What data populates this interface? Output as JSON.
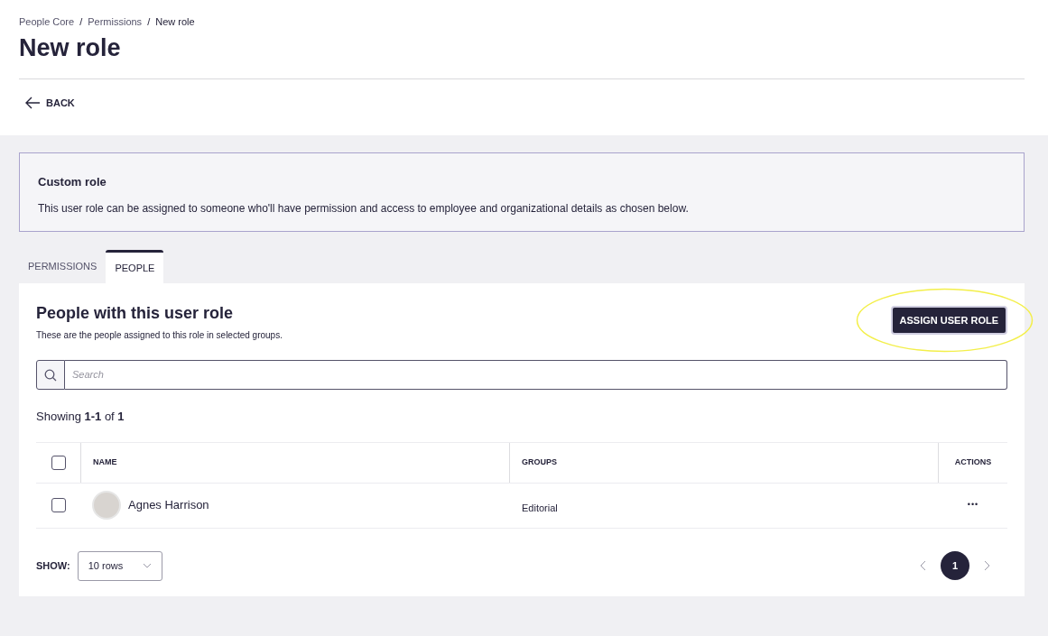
{
  "breadcrumb": [
    "People Core",
    "Permissions",
    "New role"
  ],
  "breadcrumb_separator": "/",
  "title": "New role",
  "back": "BACK",
  "info_card": {
    "title": "Custom role",
    "text": "This user role can be assigned to someone who'll have permission and access to employee and organizational details as chosen below."
  },
  "tabs": [
    {
      "label": "PERMISSIONS",
      "selected": false
    },
    {
      "label": "PEOPLE",
      "selected": true
    }
  ],
  "panel": {
    "title": "People with this user role",
    "subtitle": "These are the people assigned to this role in selected groups.",
    "assign_button": "ASSIGN USER ROLE",
    "highlighted": true
  },
  "search": {
    "placeholder": "Search"
  },
  "showing": "Showing **1-1** of **1**",
  "table": {
    "select_all_checked": false,
    "columns": [
      "NAME",
      "GROUPS",
      "ACTIONS"
    ],
    "rows": [
      {
        "name": "Agnes Harrison",
        "groups": "Editorial",
        "actions": "•••",
        "checked": false
      }
    ]
  },
  "page_size": {
    "label": "SHOW:",
    "value": "10 rows"
  },
  "pagination": {
    "pages": [
      {
        "label": "1",
        "selected": true
      }
    ]
  }
}
